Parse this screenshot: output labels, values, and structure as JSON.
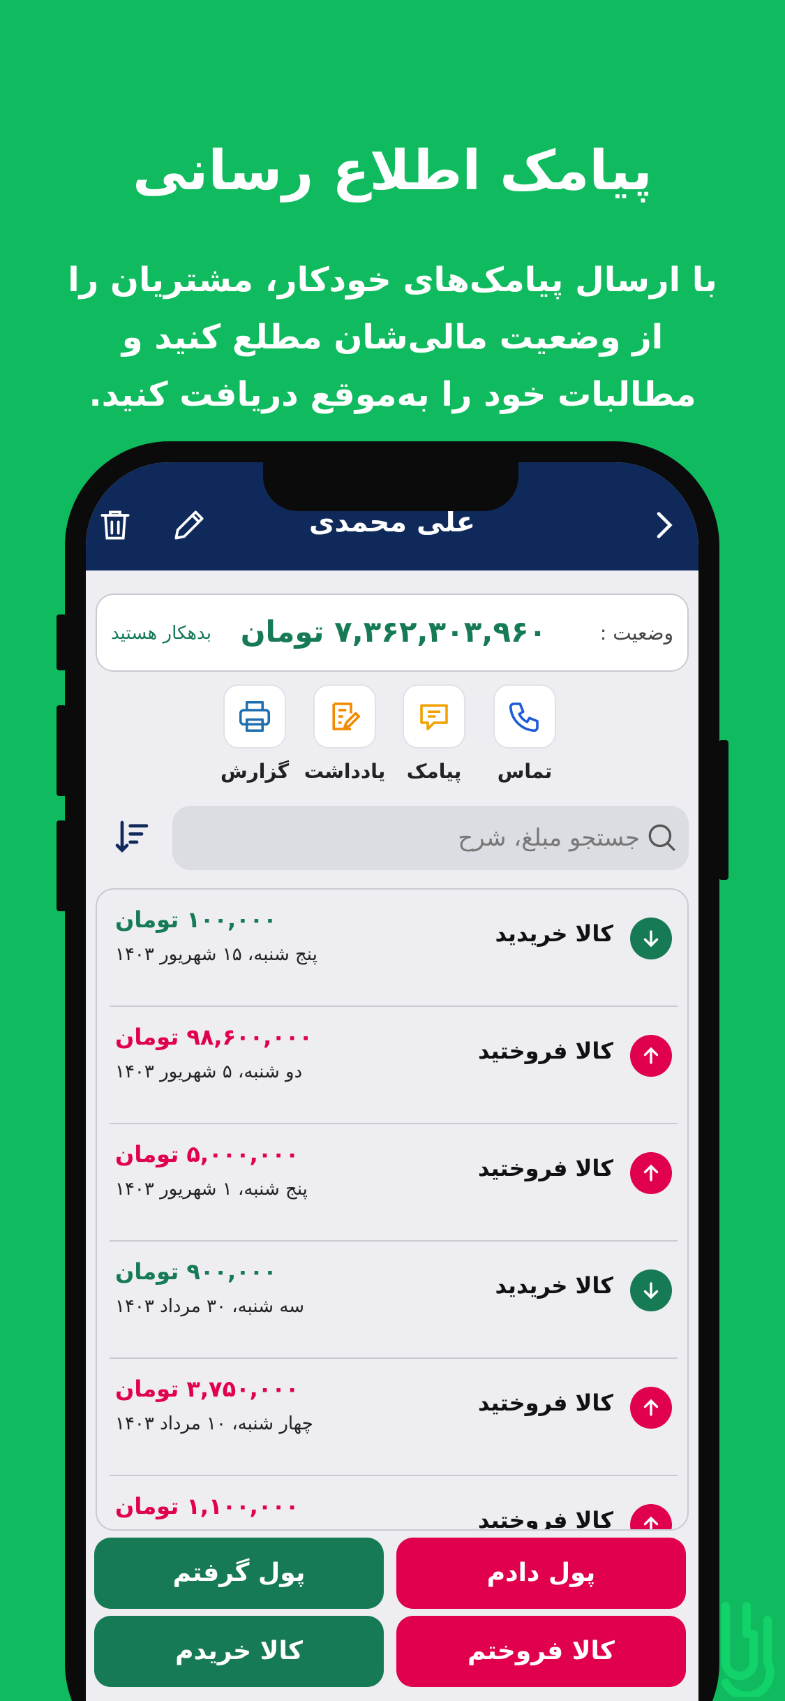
{
  "promo": {
    "title": "پیامک اطلاع رسانی",
    "subtitle": "با ارسال پیامک‌های خودکار، مشتریان را از وضعیت مالی‌شان مطلع کنید و مطالبات خود را به‌موقع دریافت کنید."
  },
  "header": {
    "title": "علی محمدی"
  },
  "status": {
    "label": "وضعیت :",
    "amount": "۷,۳۶۲,۳۰۳,۹۶۰ تومان",
    "note": "بدهکار هستید"
  },
  "actions": [
    {
      "label": "تماس",
      "icon": "phone-icon"
    },
    {
      "label": "پیامک",
      "icon": "message-icon"
    },
    {
      "label": "یادداشت",
      "icon": "note-icon"
    },
    {
      "label": "گزارش",
      "icon": "printer-icon"
    }
  ],
  "search": {
    "placeholder": "جستجو مبلغ، شرح"
  },
  "transactions": [
    {
      "title": "کالا خریدید",
      "amount": "۱۰۰,۰۰۰ تومان",
      "date": "پنج شنبه، ۱۵ شهریور ۱۴۰۳",
      "direction": "in"
    },
    {
      "title": "کالا فروختید",
      "amount": "۹۸,۶۰۰,۰۰۰ تومان",
      "date": "دو شنبه، ۵ شهریور ۱۴۰۳",
      "direction": "out"
    },
    {
      "title": "کالا فروختید",
      "amount": "۵,۰۰۰,۰۰۰ تومان",
      "date": "پنج شنبه، ۱ شهریور ۱۴۰۳",
      "direction": "out"
    },
    {
      "title": "کالا خریدید",
      "amount": "۹۰۰,۰۰۰ تومان",
      "date": "سه شنبه، ۳۰ مرداد ۱۴۰۳",
      "direction": "in"
    },
    {
      "title": "کالا فروختید",
      "amount": "۳,۷۵۰,۰۰۰ تومان",
      "date": "چهار شنبه، ۱۰ مرداد ۱۴۰۳",
      "direction": "out"
    },
    {
      "title": "کالا فروختید",
      "amount": "۱,۱۰۰,۰۰۰ تومان",
      "date": "",
      "direction": "out"
    }
  ],
  "buttons": {
    "gave_money": "پول دادم",
    "got_money": "پول گرفتم",
    "sold_goods": "کالا فروختم",
    "bought_goods": "کالا خریدم"
  },
  "colors": {
    "background": "#0fbb5e",
    "header": "#0f2a5a",
    "green": "#167a55",
    "red": "#e0004d"
  }
}
